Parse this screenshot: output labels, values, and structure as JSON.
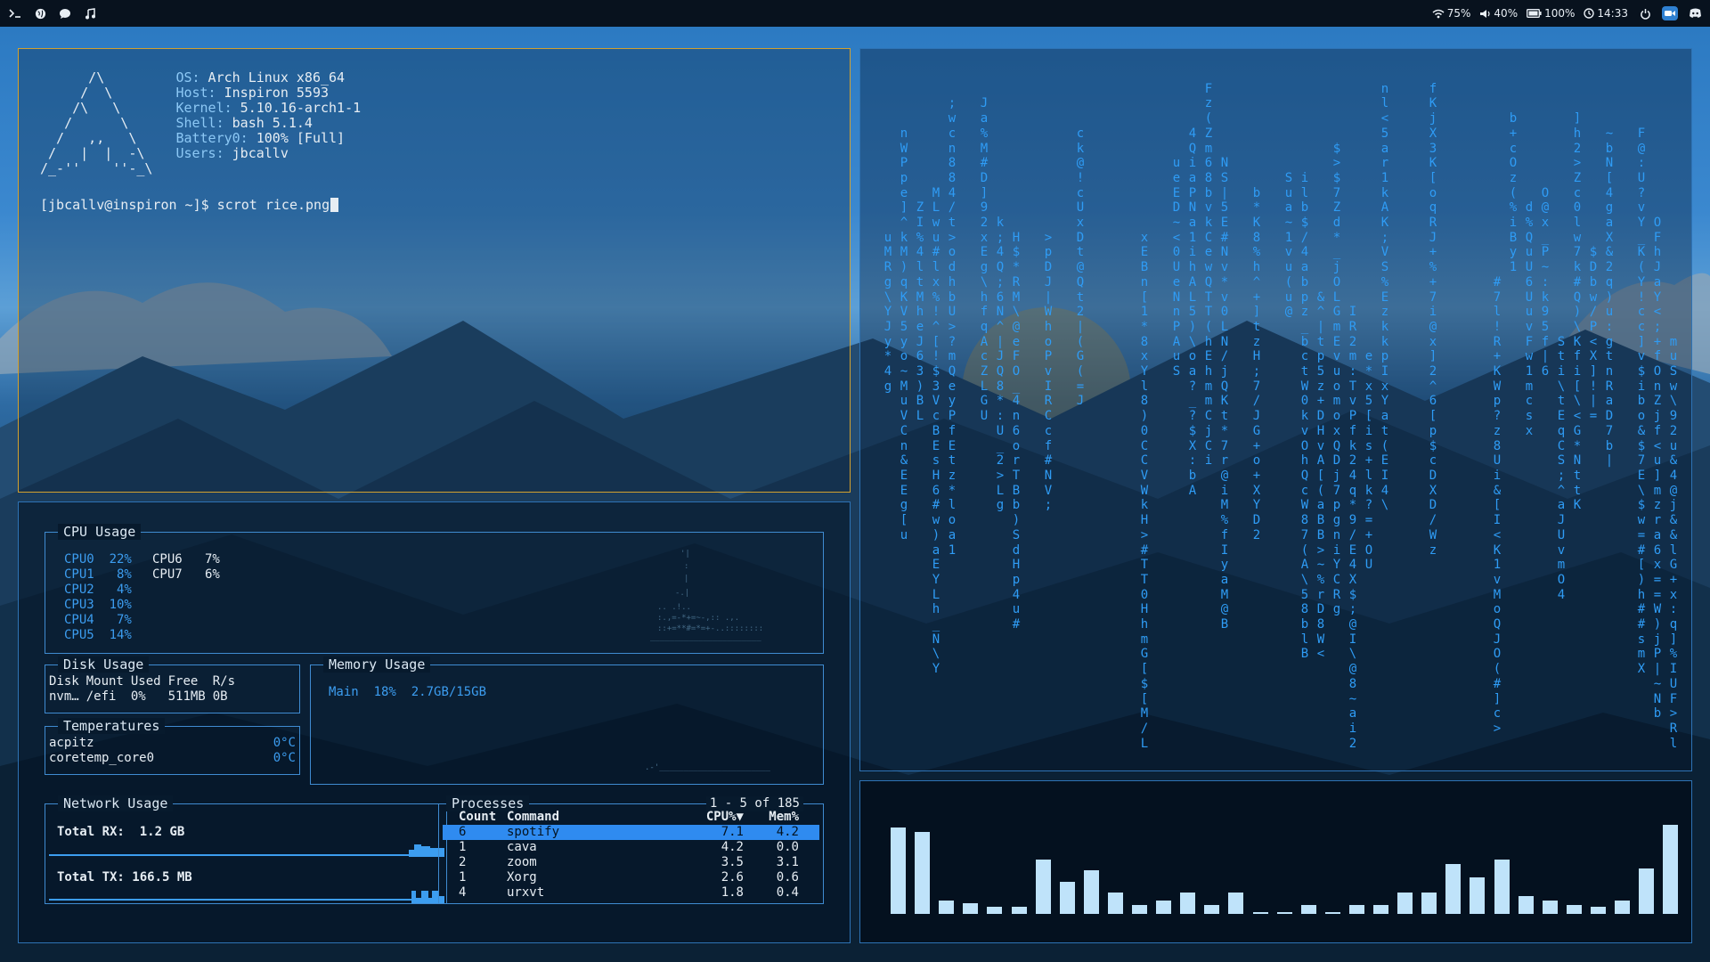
{
  "topbar": {
    "left_icons": [
      "terminal-icon",
      "globe-icon",
      "chat-icon",
      "music-icon"
    ],
    "wifi": "75%",
    "volume": "40%",
    "battery": "100%",
    "clock": "14:33"
  },
  "terminal": {
    "logo_lines": [
      "      /\\",
      "     /  \\",
      "    /\\   \\",
      "   /      \\",
      "  /   ,,   \\",
      " /   |  |  -\\",
      "/_-''    ''-_\\"
    ],
    "info": [
      {
        "key": "OS:",
        "val": " Arch Linux x86_64"
      },
      {
        "key": "Host:",
        "val": " Inspiron 5593"
      },
      {
        "key": "Kernel:",
        "val": " 5.10.16-arch1-1"
      },
      {
        "key": "Shell:",
        "val": " bash 5.1.4"
      },
      {
        "key": "Battery0:",
        "val": " 100% [Full]"
      },
      {
        "key": "Users:",
        "val": " jbcallv"
      }
    ],
    "prompt": "[jbcallv@inspiron ~]$ scrot rice.png"
  },
  "conky": {
    "cpu": {
      "title": "CPU Usage",
      "left": [
        {
          "name": "CPU0",
          "val": "22%"
        },
        {
          "name": "CPU1",
          "val": " 8%"
        },
        {
          "name": "CPU2",
          "val": " 4%"
        },
        {
          "name": "CPU3",
          "val": "10%"
        },
        {
          "name": "CPU4",
          "val": " 7%"
        },
        {
          "name": "CPU5",
          "val": "14%"
        }
      ],
      "right": [
        {
          "name": "CPU6",
          "val": " 7%"
        },
        {
          "name": "CPU7",
          "val": " 6%"
        }
      ]
    },
    "disk": {
      "title": "Disk Usage",
      "headers": [
        "Disk",
        "Mount",
        "Used",
        "Free",
        "R/s"
      ],
      "row": [
        "nvm…",
        "/efi",
        "0%",
        "511MB",
        "0B"
      ]
    },
    "temps": {
      "title": "Temperatures",
      "rows": [
        {
          "name": "acpitz",
          "val": "0°C"
        },
        {
          "name": "coretemp_core0",
          "val": "0°C"
        }
      ]
    },
    "memory": {
      "title": "Memory Usage",
      "label": "Main",
      "percent": "18%",
      "amount": "2.7GB/15GB"
    },
    "network": {
      "title": "Network Usage",
      "rx_label": "Total RX:",
      "rx_val": "1.2 GB",
      "tx_label": "Total TX:",
      "tx_val": "166.5 MB"
    },
    "processes": {
      "title": "Processes",
      "range": "1 - 5 of 185",
      "headers": {
        "count": "Count",
        "command": "Command",
        "cpu": "CPU%▼",
        "mem": "Mem%"
      },
      "rows": [
        {
          "count": "6",
          "command": "spotify",
          "cpu": "7.1",
          "mem": "4.2",
          "selected": true
        },
        {
          "count": "1",
          "command": "cava",
          "cpu": "4.2",
          "mem": "0.0"
        },
        {
          "count": "2",
          "command": "zoom",
          "cpu": "3.5",
          "mem": "3.1"
        },
        {
          "count": "1",
          "command": "Xorg",
          "cpu": "2.6",
          "mem": "0.6"
        },
        {
          "count": "4",
          "command": "urxvt",
          "cpu": "1.8",
          "mem": "0.4"
        }
      ]
    }
  },
  "cava_levels": [
    0.95,
    0.9,
    0.15,
    0.12,
    0.08,
    0.08,
    0.6,
    0.35,
    0.48,
    0.24,
    0.1,
    0.15,
    0.24,
    0.1,
    0.24,
    0.02,
    0.02,
    0.1,
    0.02,
    0.1,
    0.1,
    0.24,
    0.24,
    0.55,
    0.4,
    0.6,
    0.2,
    0.15,
    0.1,
    0.08,
    0.15,
    0.5,
    0.98
  ],
  "colors": {
    "accent": "#3c9df0",
    "border": "#2e73b5",
    "terminal_border": "#d2a12f",
    "cava_bar": "#bfe3fa"
  }
}
